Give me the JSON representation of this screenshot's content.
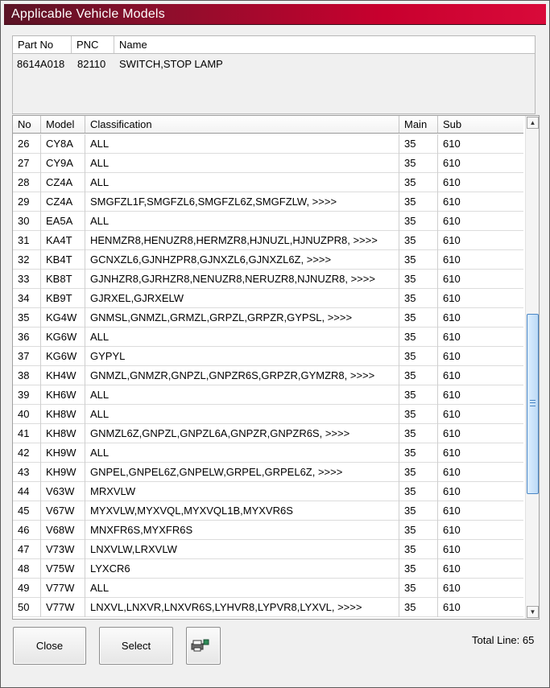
{
  "window": {
    "title": "Applicable Vehicle Models"
  },
  "part": {
    "headers": [
      "Part No",
      "PNC",
      "Name"
    ],
    "part_no": "8614A018",
    "pnc": "82110",
    "name": "SWITCH,STOP LAMP"
  },
  "grid": {
    "headers": [
      "No",
      "Model",
      "Classification",
      "Main",
      "Sub"
    ],
    "rows": [
      {
        "no": "26",
        "model": "CY8A",
        "classification": "ALL",
        "main": "35",
        "sub": "610"
      },
      {
        "no": "27",
        "model": "CY9A",
        "classification": "ALL",
        "main": "35",
        "sub": "610"
      },
      {
        "no": "28",
        "model": "CZ4A",
        "classification": "ALL",
        "main": "35",
        "sub": "610"
      },
      {
        "no": "29",
        "model": "CZ4A",
        "classification": "SMGFZL1F,SMGFZL6,SMGFZL6Z,SMGFZLW,   >>>>",
        "main": "35",
        "sub": "610"
      },
      {
        "no": "30",
        "model": "EA5A",
        "classification": "ALL",
        "main": "35",
        "sub": "610"
      },
      {
        "no": "31",
        "model": "KA4T",
        "classification": "HENMZR8,HENUZR8,HERMZR8,HJNUZL,HJNUZPR8,   >>>>",
        "main": "35",
        "sub": "610"
      },
      {
        "no": "32",
        "model": "KB4T",
        "classification": "GCNXZL6,GJNHZPR8,GJNXZL6,GJNXZL6Z,   >>>>",
        "main": "35",
        "sub": "610"
      },
      {
        "no": "33",
        "model": "KB8T",
        "classification": "GJNHZR8,GJRHZR8,NENUZR8,NERUZR8,NJNUZR8,   >>>>",
        "main": "35",
        "sub": "610"
      },
      {
        "no": "34",
        "model": "KB9T",
        "classification": "GJRXEL,GJRXELW",
        "main": "35",
        "sub": "610"
      },
      {
        "no": "35",
        "model": "KG4W",
        "classification": "GNMSL,GNMZL,GRMZL,GRPZL,GRPZR,GYPSL,   >>>>",
        "main": "35",
        "sub": "610"
      },
      {
        "no": "36",
        "model": "KG6W",
        "classification": "ALL",
        "main": "35",
        "sub": "610"
      },
      {
        "no": "37",
        "model": "KG6W",
        "classification": "GYPYL",
        "main": "35",
        "sub": "610"
      },
      {
        "no": "38",
        "model": "KH4W",
        "classification": "GNMZL,GNMZR,GNPZL,GNPZR6S,GRPZR,GYMZR8,   >>>>",
        "main": "35",
        "sub": "610"
      },
      {
        "no": "39",
        "model": "KH6W",
        "classification": "ALL",
        "main": "35",
        "sub": "610"
      },
      {
        "no": "40",
        "model": "KH8W",
        "classification": "ALL",
        "main": "35",
        "sub": "610"
      },
      {
        "no": "41",
        "model": "KH8W",
        "classification": "GNMZL6Z,GNPZL,GNPZL6A,GNPZR,GNPZR6S,   >>>>",
        "main": "35",
        "sub": "610"
      },
      {
        "no": "42",
        "model": "KH9W",
        "classification": "ALL",
        "main": "35",
        "sub": "610"
      },
      {
        "no": "43",
        "model": "KH9W",
        "classification": "GNPEL,GNPEL6Z,GNPELW,GRPEL,GRPEL6Z,   >>>>",
        "main": "35",
        "sub": "610"
      },
      {
        "no": "44",
        "model": "V63W",
        "classification": "MRXVLW",
        "main": "35",
        "sub": "610"
      },
      {
        "no": "45",
        "model": "V67W",
        "classification": "MYXVLW,MYXVQL,MYXVQL1B,MYXVR6S",
        "main": "35",
        "sub": "610"
      },
      {
        "no": "46",
        "model": "V68W",
        "classification": "MNXFR6S,MYXFR6S",
        "main": "35",
        "sub": "610"
      },
      {
        "no": "47",
        "model": "V73W",
        "classification": "LNXVLW,LRXVLW",
        "main": "35",
        "sub": "610"
      },
      {
        "no": "48",
        "model": "V75W",
        "classification": "LYXCR6",
        "main": "35",
        "sub": "610"
      },
      {
        "no": "49",
        "model": "V77W",
        "classification": "ALL",
        "main": "35",
        "sub": "610"
      },
      {
        "no": "50",
        "model": "V77W",
        "classification": "LNXVL,LNXVR,LNXVR6S,LYHVR8,LYPVR8,LYXVL,   >>>>",
        "main": "35",
        "sub": "610"
      }
    ],
    "scroll": {
      "position_fraction": 0.6
    }
  },
  "buttons": {
    "close": "Close",
    "select": "Select",
    "print_icon": "printer-icon"
  },
  "footer": {
    "total": "Total Line: 65"
  },
  "colors": {
    "title_start": "#5a1325",
    "title_end": "#d90a3a",
    "scroll_thumb": "#bcd9f5"
  }
}
